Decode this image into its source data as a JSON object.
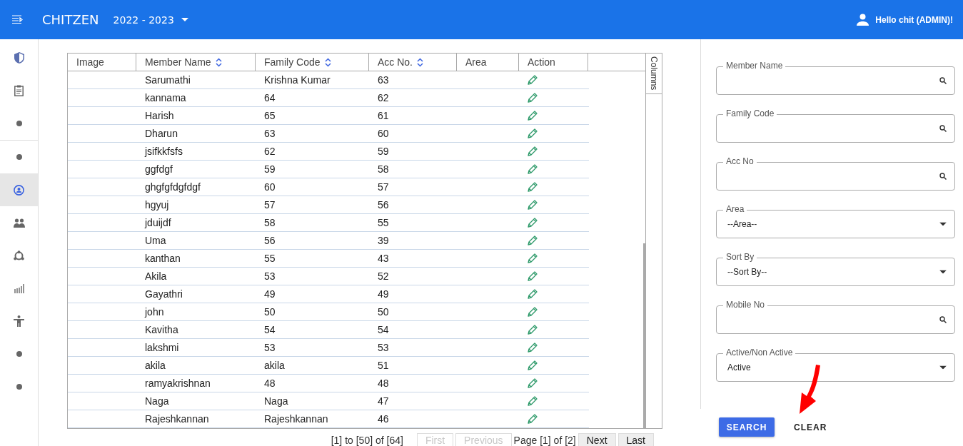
{
  "header": {
    "brand": "CHITZEN",
    "year": "2022 - 2023",
    "greeting": "Hello chit (ADMIN)!"
  },
  "sidebar": {
    "items": [
      {
        "kind": "shield",
        "selected": false
      },
      {
        "kind": "clipboard",
        "selected": false
      },
      {
        "kind": "dot",
        "selected": false
      },
      {
        "kind": "divider"
      },
      {
        "kind": "dot",
        "selected": false
      },
      {
        "kind": "person",
        "selected": true
      },
      {
        "kind": "people",
        "selected": false
      },
      {
        "kind": "cycle",
        "selected": false
      },
      {
        "kind": "chart",
        "selected": false
      },
      {
        "kind": "figure",
        "selected": false
      },
      {
        "kind": "dot",
        "selected": false
      },
      {
        "kind": "dot",
        "selected": false
      }
    ]
  },
  "table": {
    "columns": [
      {
        "label": "Image",
        "sortable": false
      },
      {
        "label": "Member Name",
        "sortable": true
      },
      {
        "label": "Family Code",
        "sortable": true
      },
      {
        "label": "Acc No.",
        "sortable": true
      },
      {
        "label": "Area",
        "sortable": false
      },
      {
        "label": "Action",
        "sortable": false
      }
    ],
    "columns_toggle": "Columns",
    "rows": [
      {
        "member_name": "Sarumathi",
        "family_code": "Krishna Kumar",
        "acc_no": "63"
      },
      {
        "member_name": "kannama",
        "family_code": "64",
        "acc_no": "62"
      },
      {
        "member_name": "Harish",
        "family_code": "65",
        "acc_no": "61"
      },
      {
        "member_name": "Dharun",
        "family_code": "63",
        "acc_no": "60"
      },
      {
        "member_name": "jsifkkfsfs",
        "family_code": "62",
        "acc_no": "59"
      },
      {
        "member_name": "ggfdgf",
        "family_code": "59",
        "acc_no": "58"
      },
      {
        "member_name": "ghgfgfdgfdgf",
        "family_code": "60",
        "acc_no": "57"
      },
      {
        "member_name": "hgyuj",
        "family_code": "57",
        "acc_no": "56"
      },
      {
        "member_name": "jduijdf",
        "family_code": "58",
        "acc_no": "55"
      },
      {
        "member_name": "Uma",
        "family_code": "56",
        "acc_no": "39"
      },
      {
        "member_name": "kanthan",
        "family_code": "55",
        "acc_no": "43"
      },
      {
        "member_name": "Akila",
        "family_code": "53",
        "acc_no": "52"
      },
      {
        "member_name": "Gayathri",
        "family_code": "49",
        "acc_no": "49"
      },
      {
        "member_name": "john",
        "family_code": "50",
        "acc_no": "50"
      },
      {
        "member_name": "Kavitha",
        "family_code": "54",
        "acc_no": "54"
      },
      {
        "member_name": "lakshmi",
        "family_code": "53",
        "acc_no": "53"
      },
      {
        "member_name": "akila",
        "family_code": "akila",
        "acc_no": "51"
      },
      {
        "member_name": "ramyakrishnan",
        "family_code": "48",
        "acc_no": "48"
      },
      {
        "member_name": "Naga",
        "family_code": "Naga",
        "acc_no": "47"
      },
      {
        "member_name": "Rajeshkannan",
        "family_code": "Rajeshkannan",
        "acc_no": "46"
      }
    ]
  },
  "pagination": {
    "summary": "[1] to [50] of [64]",
    "page": "Page [1] of [2]",
    "buttons": [
      {
        "label": "First",
        "disabled": true
      },
      {
        "label": "Previous",
        "disabled": true
      },
      {
        "label": "Next",
        "disabled": false
      },
      {
        "label": "Last",
        "disabled": false
      }
    ]
  },
  "filters": [
    {
      "kind": "search",
      "label": "Member Name"
    },
    {
      "kind": "search",
      "label": "Family Code"
    },
    {
      "kind": "search",
      "label": "Acc No"
    },
    {
      "kind": "select",
      "label": "Area",
      "value": "--Area--"
    },
    {
      "kind": "select",
      "label": "Sort By",
      "value": "--Sort By--"
    },
    {
      "kind": "search",
      "label": "Mobile No"
    },
    {
      "kind": "select",
      "label": "Active/Non Active",
      "value": "Active"
    }
  ],
  "actions": {
    "search": "SEARCH",
    "clear": "CLEAR"
  }
}
